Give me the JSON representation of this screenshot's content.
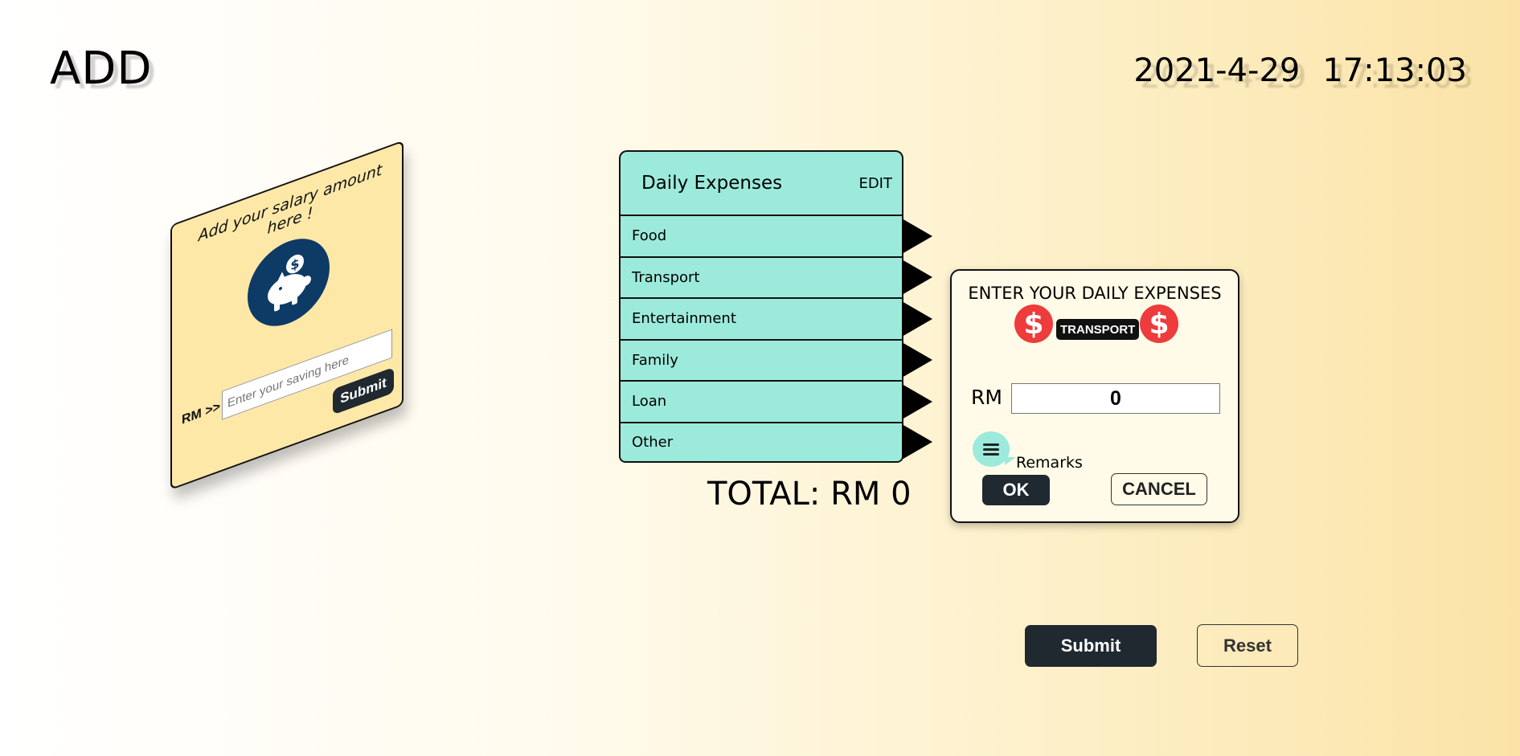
{
  "header": {
    "title": "ADD",
    "date": "2021-4-29",
    "time": "17:13:03"
  },
  "salary_card": {
    "heading": "Add your salary amount here !",
    "icon": "piggy-bank-icon",
    "rm_label": "RM >>",
    "input_placeholder": "Enter your saving here",
    "input_value": "",
    "submit_label": "Submit"
  },
  "expenses": {
    "title": "Daily Expenses",
    "edit_label": "EDIT",
    "items": [
      {
        "label": "Food"
      },
      {
        "label": "Transport"
      },
      {
        "label": "Entertainment"
      },
      {
        "label": "Family"
      },
      {
        "label": "Loan"
      },
      {
        "label": "Other"
      }
    ],
    "total_text": "TOTAL: RM 0"
  },
  "dialog": {
    "title": "ENTER YOUR DAILY EXPENSES",
    "dollar_icon": "dollar-icon",
    "dollar_symbol": "$",
    "category": "TRANSPORT",
    "rm_label": "RM",
    "amount": "0",
    "remarks_icon": "chat-menu-icon",
    "remarks_label": "Remarks",
    "ok_label": "OK",
    "cancel_label": "CANCEL"
  },
  "actions": {
    "submit_label": "Submit",
    "reset_label": "Reset"
  },
  "colors": {
    "teal": "#9ceadb",
    "card_yellow": "#fde8a8",
    "navy": "#0e3a66",
    "dark_button": "#202830",
    "dollar_red": "#ee3b3b"
  }
}
